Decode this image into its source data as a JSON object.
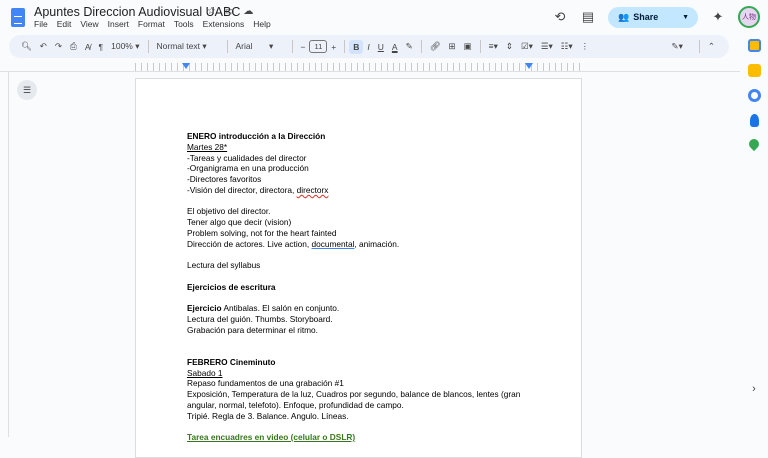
{
  "title": "Apuntes Direccion Audiovisual UABC",
  "menu": [
    "File",
    "Edit",
    "View",
    "Insert",
    "Format",
    "Tools",
    "Extensions",
    "Help"
  ],
  "share_label": "Share",
  "avatar_text": "人物",
  "toolbar": {
    "zoom": "100%",
    "style": "Normal text",
    "font": "Arial",
    "font_size": "11"
  },
  "doc": [
    {
      "t": "ENERO introducción a la Dirección",
      "s": "b"
    },
    {
      "t": "Martes 28*",
      "s": "u"
    },
    {
      "t": "-Tareas y cualidades del director"
    },
    {
      "t": "-Organigrama en una producción"
    },
    {
      "t": "-Directores favoritos"
    },
    {
      "t": "-Visión del director, directora, ",
      "extra": "directorx",
      "es": "spell"
    },
    {
      "t": ""
    },
    {
      "t": "El objetivo del director."
    },
    {
      "t": "Tener algo que decir (vision)"
    },
    {
      "t": "Problem solving, not for the heart fainted"
    },
    {
      "t": "Dirección de actores. Live action, ",
      "extra": "documental",
      "es": "gram",
      "after": ", animación."
    },
    {
      "t": ""
    },
    {
      "t": "Lectura del syllabus"
    },
    {
      "t": ""
    },
    {
      "t": "Ejercicios de escritura",
      "s": "b"
    },
    {
      "t": ""
    },
    {
      "t": "Ejercicio",
      "s2": "b",
      "after": " Antibalas. El salón en conjunto."
    },
    {
      "t": "Lectura del guión. Thumbs. Storyboard."
    },
    {
      "t": "Grabación para determinar el ritmo."
    },
    {
      "t": ""
    },
    {
      "t": ""
    },
    {
      "t": "FEBRERO Cineminuto",
      "s": "b"
    },
    {
      "t": "Sabado 1",
      "s": "u"
    },
    {
      "t": "Repaso fundamentos de una grabación #1"
    },
    {
      "t": "Exposición, Temperatura de la luz, Cuadros por segundo, balance de blancos, lentes (gran"
    },
    {
      "t": "angular, normal, telefoto). Enfoque, profundidad de campo."
    },
    {
      "t": "Tripié. Regla de 3. Balance. Angulo. Líneas."
    },
    {
      "t": ""
    },
    {
      "t": "Tarea encuadres en video (celular o DSLR)",
      "s": "green"
    }
  ]
}
